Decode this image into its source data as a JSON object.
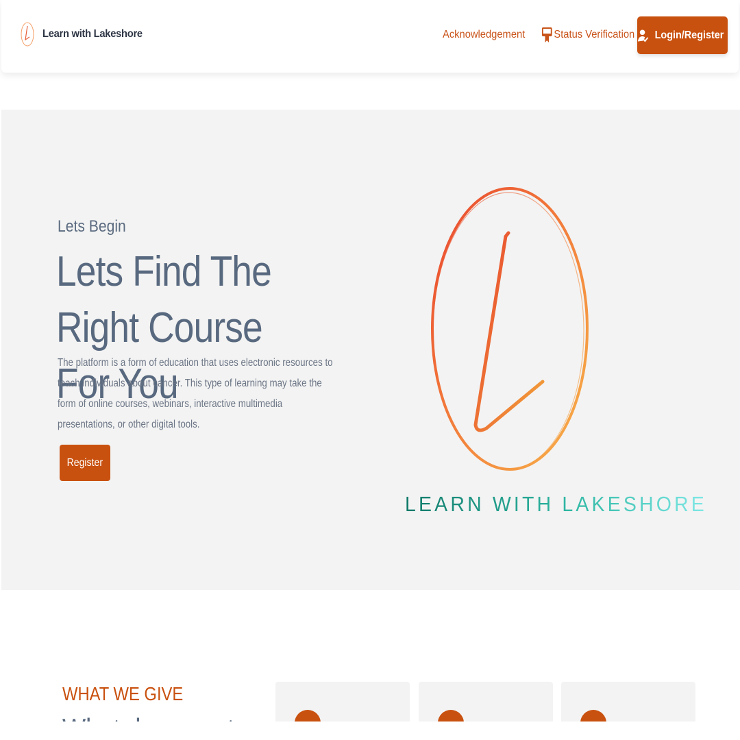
{
  "header": {
    "brand_name": "Learn with Lakeshore",
    "nav": {
      "acknowledgement": "Acknowledgement",
      "status_verification": "Status Verification",
      "login_register": "Login/Register"
    }
  },
  "hero": {
    "eyebrow": "Lets Begin",
    "title": "Lets Find The Right Course For You",
    "description": "The platform is a form of education that uses electronic resources to teach individuals about cancer. This type of learning may take the form of online courses, webinars, interactive multimedia presentations, or other digital tools.",
    "register_label": "Register",
    "logo_text": "LEARN WITH LAKESHORE"
  },
  "features": {
    "label": "WHAT WE GIVE",
    "title": "What do we get"
  },
  "colors": {
    "accent": "#c9510f",
    "heading": "#58697f",
    "hero_bg": "#f3f3f3",
    "logo_text_start": "#117a6a",
    "logo_text_end": "#7fe8e6"
  },
  "icons": {
    "brand": "lakeshore-logo-icon",
    "status": "certificate-icon",
    "login": "user-check-icon"
  }
}
